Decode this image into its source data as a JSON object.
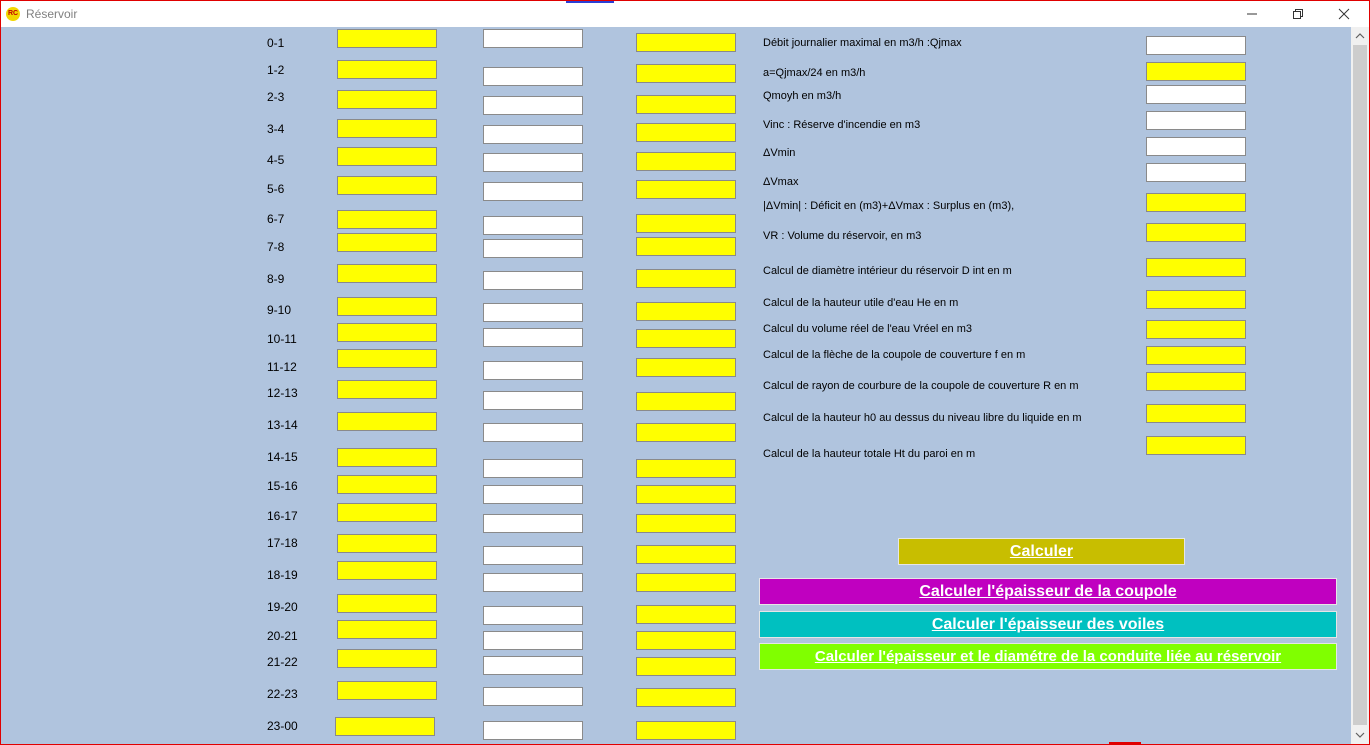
{
  "window": {
    "title": "Réservoir",
    "app_icon_text": "RC",
    "buttons": [
      "minimize-icon",
      "restore-icon",
      "close-icon"
    ]
  },
  "colors": {
    "background": "#b0c4de",
    "yellow_field": "#ffff00",
    "btn_calculer": "#c8be00",
    "btn_coupole": "#c000c0",
    "btn_voiles": "#00c0c0",
    "btn_conduite": "#80ff00"
  },
  "rows": [
    {
      "label": "0-1"
    },
    {
      "label": "1-2"
    },
    {
      "label": "2-3"
    },
    {
      "label": "3-4"
    },
    {
      "label": "4-5"
    },
    {
      "label": "5-6"
    },
    {
      "label": "6-7"
    },
    {
      "label": "7-8"
    },
    {
      "label": "8-9"
    },
    {
      "label": "9-10"
    },
    {
      "label": "10-11"
    },
    {
      "label": "11-12"
    },
    {
      "label": "12-13"
    },
    {
      "label": "13-14"
    },
    {
      "label": "14-15"
    },
    {
      "label": "15-16"
    },
    {
      "label": "16-17"
    },
    {
      "label": "17-18"
    },
    {
      "label": "18-19"
    },
    {
      "label": "19-20"
    },
    {
      "label": "20-21"
    },
    {
      "label": "21-22"
    },
    {
      "label": "22-23"
    },
    {
      "label": "23-00"
    }
  ],
  "fields": [
    {
      "label": "Débit journalier maximal en m3/h :Qjmax",
      "value": ""
    },
    {
      "label": "a=Qjmax/24 en m3/h",
      "value": ""
    },
    {
      "label": "Qmoyh en m3/h",
      "value": ""
    },
    {
      "label": "Vinc : Réserve d'incendie en m3",
      "value": ""
    },
    {
      "label": "ΔVmin",
      "value": ""
    },
    {
      "label": "ΔVmax",
      "value": ""
    },
    {
      "label": "|ΔVmin| : Déficit  en (m3)+ΔVmax : Surplus en (m3),",
      "value": ""
    },
    {
      "label": "VR : Volume du réservoir, en m3",
      "value": ""
    },
    {
      "label": "Calcul de diamètre intérieur du réservoir D int  en m",
      "value": ""
    },
    {
      "label": "Calcul de la hauteur utile d'eau He en m",
      "value": ""
    },
    {
      "label": "Calcul du volume réel de l'eau Vréel en m3",
      "value": ""
    },
    {
      "label": "Calcul de la flèche de la coupole de couverture f en m",
      "value": ""
    },
    {
      "label": "Calcul de rayon de courbure de la coupole de couverture R en m",
      "value": ""
    },
    {
      "label": "Calcul de la hauteur h0  au dessus du niveau libre du liquide  en m",
      "value": ""
    },
    {
      "label": "Calcul de la hauteur totale  Ht du paroi en m",
      "value": ""
    }
  ],
  "buttons": {
    "calculer": "Calculer",
    "coupole": "Calculer l'épaisseur de la coupole",
    "voiles": "Calculer l'épaisseur des voiles ",
    "conduite": "Calculer l'épaisseur et le diamétre de la conduite liée au réservoir"
  }
}
